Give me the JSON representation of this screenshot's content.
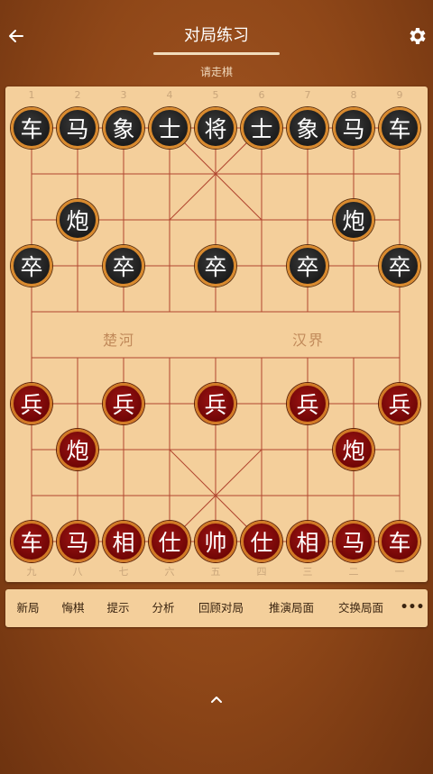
{
  "header": {
    "title": "对局练习",
    "status": "请走棋",
    "back_icon": "arrow-left-icon",
    "settings_icon": "gear-icon"
  },
  "board": {
    "files_top": [
      "1",
      "2",
      "3",
      "4",
      "5",
      "6",
      "7",
      "8",
      "9"
    ],
    "files_bottom": [
      "九",
      "八",
      "七",
      "六",
      "五",
      "四",
      "三",
      "二",
      "一"
    ],
    "river_left": "楚河",
    "river_right": "汉界",
    "pieces": [
      {
        "ch": "车",
        "side": "black",
        "col": 0,
        "row": 0
      },
      {
        "ch": "马",
        "side": "black",
        "col": 1,
        "row": 0
      },
      {
        "ch": "象",
        "side": "black",
        "col": 2,
        "row": 0
      },
      {
        "ch": "士",
        "side": "black",
        "col": 3,
        "row": 0
      },
      {
        "ch": "将",
        "side": "black",
        "col": 4,
        "row": 0
      },
      {
        "ch": "士",
        "side": "black",
        "col": 5,
        "row": 0
      },
      {
        "ch": "象",
        "side": "black",
        "col": 6,
        "row": 0
      },
      {
        "ch": "马",
        "side": "black",
        "col": 7,
        "row": 0
      },
      {
        "ch": "车",
        "side": "black",
        "col": 8,
        "row": 0
      },
      {
        "ch": "炮",
        "side": "black",
        "col": 1,
        "row": 2
      },
      {
        "ch": "炮",
        "side": "black",
        "col": 7,
        "row": 2
      },
      {
        "ch": "卒",
        "side": "black",
        "col": 0,
        "row": 3
      },
      {
        "ch": "卒",
        "side": "black",
        "col": 2,
        "row": 3
      },
      {
        "ch": "卒",
        "side": "black",
        "col": 4,
        "row": 3
      },
      {
        "ch": "卒",
        "side": "black",
        "col": 6,
        "row": 3
      },
      {
        "ch": "卒",
        "side": "black",
        "col": 8,
        "row": 3
      },
      {
        "ch": "兵",
        "side": "red",
        "col": 0,
        "row": 6
      },
      {
        "ch": "兵",
        "side": "red",
        "col": 2,
        "row": 6
      },
      {
        "ch": "兵",
        "side": "red",
        "col": 4,
        "row": 6
      },
      {
        "ch": "兵",
        "side": "red",
        "col": 6,
        "row": 6
      },
      {
        "ch": "兵",
        "side": "red",
        "col": 8,
        "row": 6
      },
      {
        "ch": "炮",
        "side": "red",
        "col": 1,
        "row": 7
      },
      {
        "ch": "炮",
        "side": "red",
        "col": 7,
        "row": 7
      },
      {
        "ch": "车",
        "side": "red",
        "col": 0,
        "row": 9
      },
      {
        "ch": "马",
        "side": "red",
        "col": 1,
        "row": 9
      },
      {
        "ch": "相",
        "side": "red",
        "col": 2,
        "row": 9
      },
      {
        "ch": "仕",
        "side": "red",
        "col": 3,
        "row": 9
      },
      {
        "ch": "帅",
        "side": "red",
        "col": 4,
        "row": 9
      },
      {
        "ch": "仕",
        "side": "red",
        "col": 5,
        "row": 9
      },
      {
        "ch": "相",
        "side": "red",
        "col": 6,
        "row": 9
      },
      {
        "ch": "马",
        "side": "red",
        "col": 7,
        "row": 9
      },
      {
        "ch": "车",
        "side": "red",
        "col": 8,
        "row": 9
      }
    ]
  },
  "toolbar": {
    "items": [
      "新局",
      "悔棋",
      "提示",
      "分析",
      "回顾对局",
      "推演局面",
      "交换局面"
    ],
    "more_label": "•••"
  },
  "footer": {
    "expand_icon": "chevron-up-icon"
  },
  "colors": {
    "background": "#8f4718",
    "board": "#f4cf9b",
    "grid_line": "#b0452f",
    "black_piece": "#1c1c1c",
    "red_piece": "#6e0505",
    "piece_rim": "#d98a2e"
  }
}
